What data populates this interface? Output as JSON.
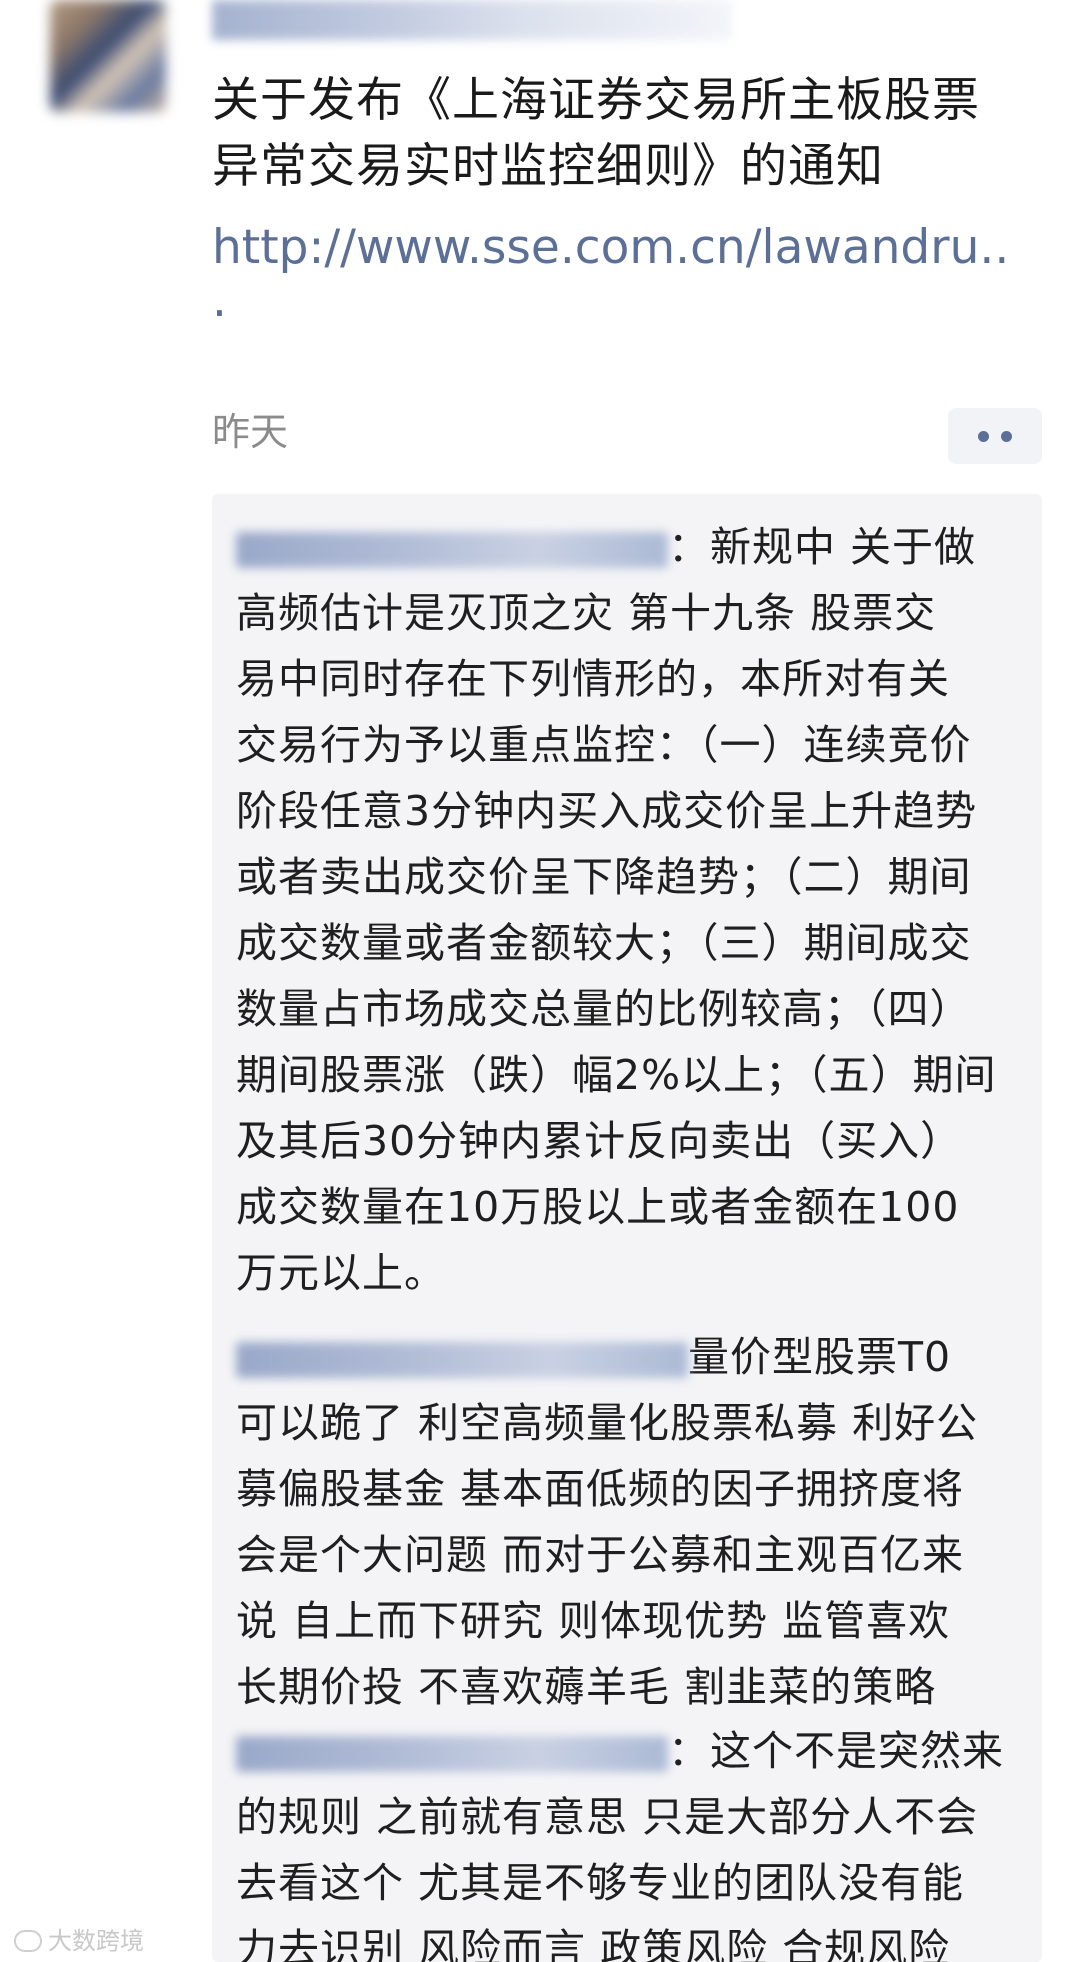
{
  "post": {
    "title_lines": [
      "关于发布《上海证券交易所主板股票",
      "异常交易实时监控细则》的通知"
    ],
    "link": "http://www.sse.com.cn/lawandru..",
    "link_tail": ".",
    "time": "昨天",
    "more_icon": "more-dots-icon"
  },
  "comments": [
    {
      "lines": [
        "：新规中 关于做",
        "高频估计是灭顶之灾  第十九条 股票交",
        "易中同时存在下列情形的，本所对有关",
        "交易行为予以重点监控：（一）连续竞价",
        "阶段任意3分钟内买入成交价呈上升趋势",
        "或者卖出成交价呈下降趋势；（二）期间",
        "成交数量或者金额较大；（三）期间成交",
        "数量占市场成交总量的比例较高；（四）",
        "期间股票涨（跌）幅2%以上；（五）期间",
        "及其后30分钟内累计反向卖出（买入）",
        "成交数量在10万股以上或者金额在100",
        "万元以上。"
      ]
    },
    {
      "lines": [
        "量价型股票T0",
        "可以跪了 利空高频量化股票私募 利好公",
        "募偏股基金 基本面低频的因子拥挤度将",
        "会是个大问题 而对于公募和主观百亿来",
        "说 自上而下研究 则体现优势 监管喜欢",
        "长期价投 不喜欢薅羊毛 割韭菜的策略"
      ]
    },
    {
      "lines": [
        "：这个不是突然来",
        "的规则 之前就有意思 只是大部分人不会",
        "去看这个 尤其是不够专业的团队没有能",
        "力去识别 风险而言 政策风险 合规风险"
      ]
    }
  ],
  "watermark": {
    "text": "大数跨境",
    "icon": "watermark-logo-icon"
  }
}
